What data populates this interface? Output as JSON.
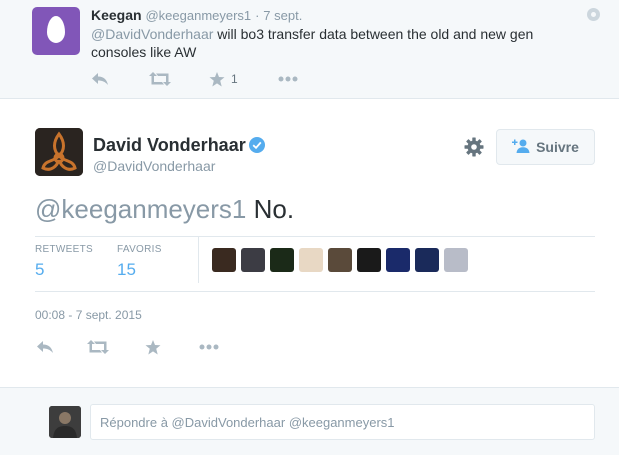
{
  "reply_tweet": {
    "name": "Keegan",
    "handle": "@keeganmeyers1",
    "dot": "·",
    "time": "7 sept.",
    "mention": "@DavidVonderhaar",
    "text": " will bo3 transfer data between the old and new gen consoles like AW",
    "favorite_count": "1",
    "icons": [
      "reply-icon",
      "retweet-icon",
      "favorite-icon",
      "more-icon",
      "close-icon"
    ]
  },
  "main_tweet": {
    "name": "David Vonderhaar",
    "handle": "@DavidVonderhaar",
    "follow_label": "Suivre",
    "mention": "@keeganmeyers1",
    "text": " No.",
    "stats": {
      "retweets_label": "RETWEETS",
      "retweets_value": "5",
      "favorites_label": "FAVORIS",
      "favorites_value": "15"
    },
    "timestamp": "00:08 - 7 sept. 2015",
    "icons": [
      "verified-badge-icon",
      "gear-icon",
      "follow-person-icon",
      "reply-icon",
      "retweet-icon",
      "favorite-icon",
      "more-icon"
    ]
  },
  "favoriters": [
    {
      "color": "#3a2a20"
    },
    {
      "color": "#3c3c44"
    },
    {
      "color": "#1b2a18"
    },
    {
      "color": "#e8d8c4"
    },
    {
      "color": "#5a4a3a"
    },
    {
      "color": "#1a1a1a"
    },
    {
      "color": "#1a2a6a"
    },
    {
      "color": "#1a2a5a"
    },
    {
      "color": "#b8bcc8"
    }
  ],
  "reply_box": {
    "placeholder": "Répondre à @DavidVonderhaar @keeganmeyers1"
  },
  "colors": {
    "accent": "#55acee",
    "muted": "#8899a6",
    "text": "#292f33",
    "panel": "#f5f8fa"
  }
}
